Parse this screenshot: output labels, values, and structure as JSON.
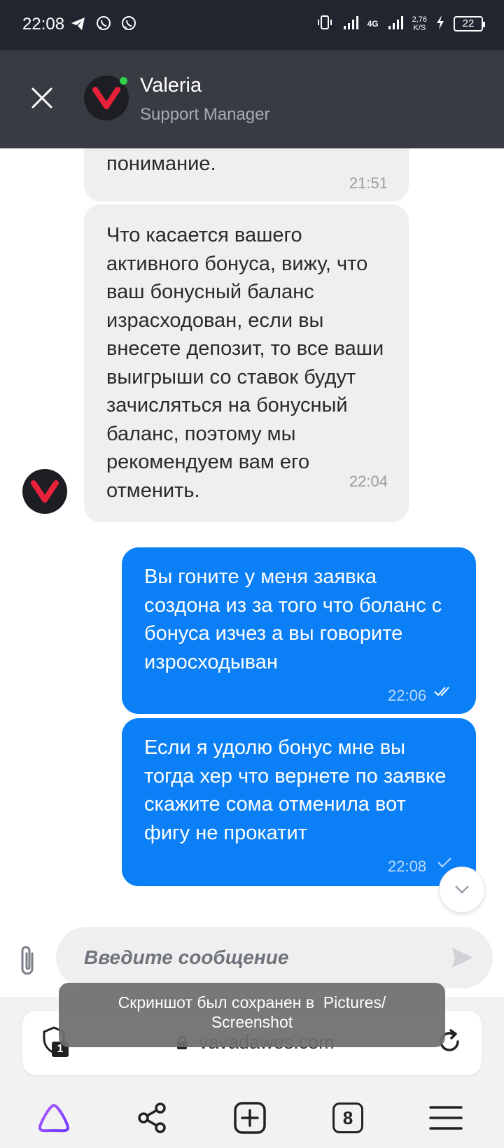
{
  "status_bar": {
    "time": "22:08",
    "network_type": "4G",
    "net_speed_value": "2,76",
    "net_speed_unit": "K/S",
    "battery": "22"
  },
  "header": {
    "agent_name": "Valeria",
    "agent_role": "Support Manager",
    "online": true
  },
  "messages": [
    {
      "direction": "incoming",
      "text": "понимание.",
      "time": "21:51"
    },
    {
      "direction": "incoming",
      "text": "Что касается вашего активного бонуса, вижу, что ваш бонусный баланс израсходован, если вы внесете депозит, то все ваши выигрыши со ставок будут зачисляться на бонусный баланс, поэтому мы рекомендуем вам его отменить.",
      "time": "22:04"
    },
    {
      "direction": "outgoing",
      "text": "Вы гоните у меня заявка создона из за того что боланс с бонуса изчез а вы говорите изросходыван",
      "time": "22:06",
      "status": "read"
    },
    {
      "direction": "outgoing",
      "text": "Если я удолю бонус мне вы тогда хер что вернете по заявке скажите сома отменила вот фигу не прокатит",
      "time": "22:08",
      "status": "delivered"
    }
  ],
  "composer": {
    "placeholder": "Введите сообщение"
  },
  "browser": {
    "url": "vavadawes.com",
    "shield_badge": "1",
    "tabs_count": "8"
  },
  "toast": {
    "line1": "Скриншот был сохранен в  Pictures/",
    "line2": "Screenshot"
  },
  "colors": {
    "status_bar_bg": "#222530",
    "header_bg": "#383b42",
    "incoming_bubble": "#efefef",
    "outgoing_bubble": "#0b7ff5",
    "brand_red": "#e8203a",
    "online_green": "#2dd14a",
    "alice_purple": "#8a4dff"
  }
}
